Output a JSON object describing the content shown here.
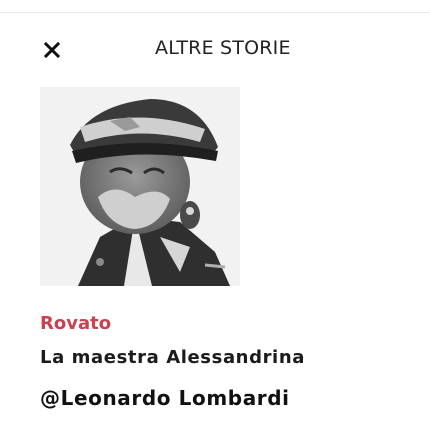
{
  "header": {
    "close_icon": "close-x-icon",
    "title": "ALTRE STORIE"
  },
  "story": {
    "image_alt": "portrait-photo",
    "category": "Rovato",
    "headline": "La maestra Alessandrina",
    "author": "@Leonardo Lombardi"
  },
  "colors": {
    "category": "#c8434e",
    "text": "#1b1b1b",
    "background": "#ffffff"
  }
}
